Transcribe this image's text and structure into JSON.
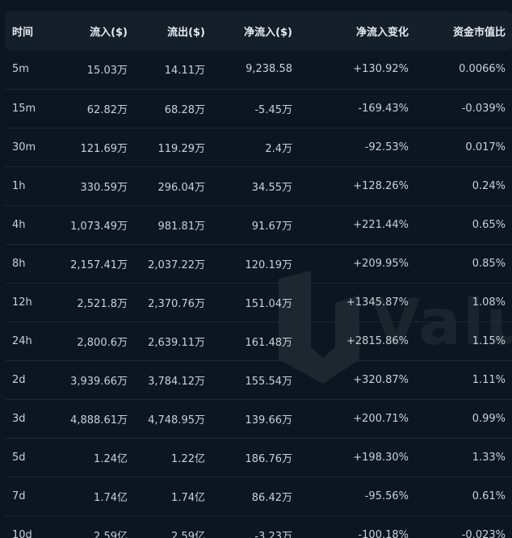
{
  "headers": [
    "时间",
    "流入($)",
    "流出($)",
    "净流入($)",
    "净流入变化",
    "资金市值比"
  ],
  "watermark": "Valu",
  "rows": [
    {
      "time": "5m",
      "inflow": "15.03万",
      "outflow": "14.11万",
      "net": "9,238.58",
      "change": "+130.92%",
      "ratio": "0.0066%",
      "net_dir": "pos",
      "change_dir": "pos",
      "ratio_dir": "pos"
    },
    {
      "time": "15m",
      "inflow": "62.82万",
      "outflow": "68.28万",
      "net": "-5.45万",
      "change": "-169.43%",
      "ratio": "-0.039%",
      "net_dir": "neg",
      "change_dir": "neg",
      "ratio_dir": "neg"
    },
    {
      "time": "30m",
      "inflow": "121.69万",
      "outflow": "119.29万",
      "net": "2.4万",
      "change": "-92.53%",
      "ratio": "0.017%",
      "net_dir": "pos",
      "change_dir": "neg",
      "ratio_dir": "pos"
    },
    {
      "time": "1h",
      "inflow": "330.59万",
      "outflow": "296.04万",
      "net": "34.55万",
      "change": "+128.26%",
      "ratio": "0.24%",
      "net_dir": "pos",
      "change_dir": "pos",
      "ratio_dir": "pos"
    },
    {
      "time": "4h",
      "inflow": "1,073.49万",
      "outflow": "981.81万",
      "net": "91.67万",
      "change": "+221.44%",
      "ratio": "0.65%",
      "net_dir": "pos",
      "change_dir": "pos",
      "ratio_dir": "pos"
    },
    {
      "time": "8h",
      "inflow": "2,157.41万",
      "outflow": "2,037.22万",
      "net": "120.19万",
      "change": "+209.95%",
      "ratio": "0.85%",
      "net_dir": "pos",
      "change_dir": "pos",
      "ratio_dir": "pos"
    },
    {
      "time": "12h",
      "inflow": "2,521.8万",
      "outflow": "2,370.76万",
      "net": "151.04万",
      "change": "+1345.87%",
      "ratio": "1.08%",
      "net_dir": "pos",
      "change_dir": "pos",
      "ratio_dir": "pos"
    },
    {
      "time": "24h",
      "inflow": "2,800.6万",
      "outflow": "2,639.11万",
      "net": "161.48万",
      "change": "+2815.86%",
      "ratio": "1.15%",
      "net_dir": "pos",
      "change_dir": "pos",
      "ratio_dir": "pos"
    },
    {
      "time": "2d",
      "inflow": "3,939.66万",
      "outflow": "3,784.12万",
      "net": "155.54万",
      "change": "+320.87%",
      "ratio": "1.11%",
      "net_dir": "pos",
      "change_dir": "pos",
      "ratio_dir": "pos"
    },
    {
      "time": "3d",
      "inflow": "4,888.61万",
      "outflow": "4,748.95万",
      "net": "139.66万",
      "change": "+200.71%",
      "ratio": "0.99%",
      "net_dir": "pos",
      "change_dir": "pos",
      "ratio_dir": "pos"
    },
    {
      "time": "5d",
      "inflow": "1.24亿",
      "outflow": "1.22亿",
      "net": "186.76万",
      "change": "+198.30%",
      "ratio": "1.33%",
      "net_dir": "pos",
      "change_dir": "pos",
      "ratio_dir": "pos"
    },
    {
      "time": "7d",
      "inflow": "1.74亿",
      "outflow": "1.74亿",
      "net": "86.42万",
      "change": "-95.56%",
      "ratio": "0.61%",
      "net_dir": "pos",
      "change_dir": "neg",
      "ratio_dir": "pos"
    },
    {
      "time": "10d",
      "inflow": "2.59亿",
      "outflow": "2.59亿",
      "net": "-3.23万",
      "change": "-100.18%",
      "ratio": "-0.023%",
      "net_dir": "neg",
      "change_dir": "neg",
      "ratio_dir": "neg"
    }
  ],
  "colors": {
    "positive": "#2ebd85",
    "negative": "#f6465d",
    "background": "#0b1620",
    "header_bg": "#141f29"
  }
}
